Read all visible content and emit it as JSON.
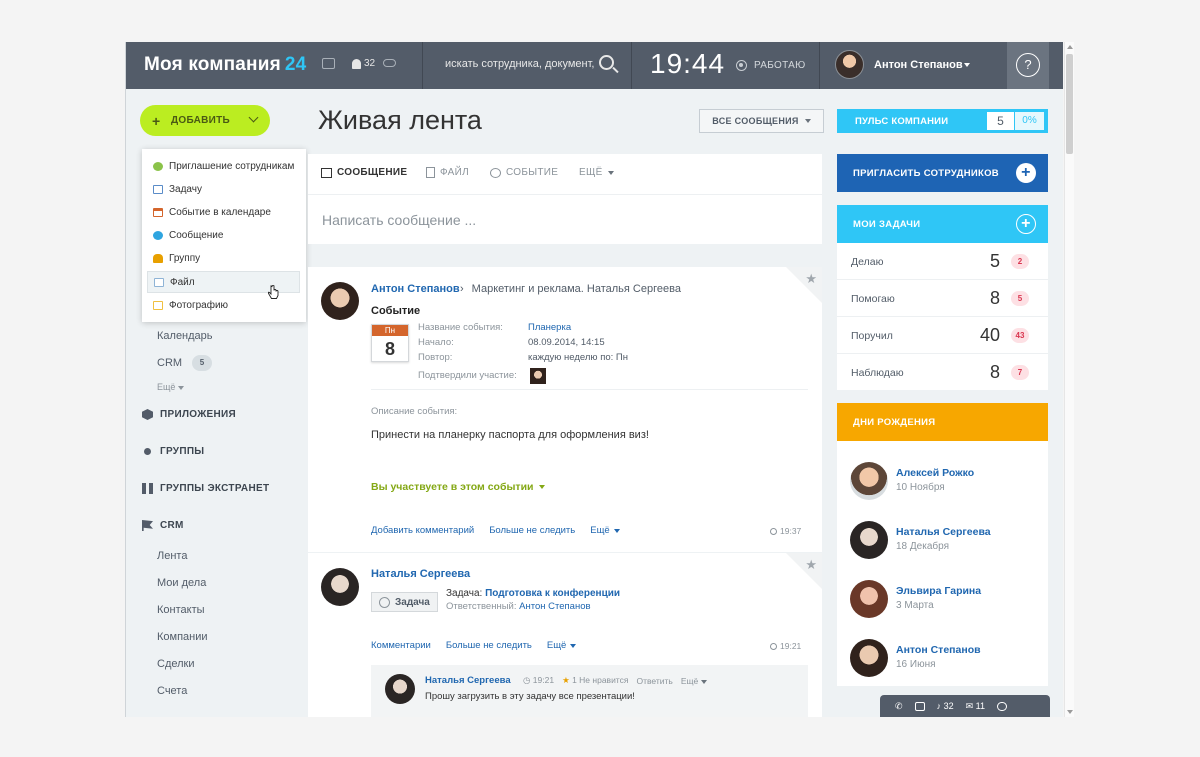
{
  "header": {
    "logo_text": "Моя компания",
    "logo_num": "24",
    "notifications_count": "32",
    "search_placeholder": "искать сотрудника, документ,",
    "clock": "19:44",
    "status": "РАБОТАЮ",
    "user_name": "Антон Степанов",
    "help": "?"
  },
  "sidebar": {
    "add_button": "ДОБАВИТЬ",
    "add_menu": [
      {
        "label": "Приглашение сотрудникам",
        "color": "#8bc34a"
      },
      {
        "label": "Задачу",
        "color": "#5a8cc8"
      },
      {
        "label": "Событие в календаре",
        "color": "#d4652c"
      },
      {
        "label": "Сообщение",
        "color": "#2fa5e0"
      },
      {
        "label": "Группу",
        "color": "#e8a000"
      },
      {
        "label": "Файл",
        "color": "#8fb4d6"
      },
      {
        "label": "Фотографию",
        "color": "#f0c040"
      }
    ],
    "calendar": "Календарь",
    "crm": "CRM",
    "crm_badge": "5",
    "more": "Ещё",
    "sections": {
      "apps": "ПРИЛОЖЕНИЯ",
      "groups": "ГРУППЫ",
      "extranet": "ГРУППЫ ЭКСТРАНЕТ",
      "crm": "CRM"
    },
    "crm_items": [
      "Лента",
      "Мои дела",
      "Контакты",
      "Компании",
      "Сделки",
      "Счета"
    ]
  },
  "feed": {
    "title": "Живая лента",
    "filter": "ВСЕ СООБЩЕНИЯ",
    "composer": {
      "tabs": [
        "СООБЩЕНИЕ",
        "ФАЙЛ",
        "СОБЫТИЕ",
        "ЕЩЁ"
      ],
      "placeholder": "Написать сообщение ..."
    },
    "post1": {
      "author": "Антон Степанов",
      "destination": "Маркетинг и реклама. Наталья Сергеева",
      "title": "Событие",
      "cal_weekday": "Пн",
      "cal_day": "8",
      "fields": [
        {
          "label": "Название события:",
          "value": "Планерка"
        },
        {
          "label": "Начало:",
          "value": "08.09.2014, 14:15"
        },
        {
          "label": "Повтор:",
          "value": "каждую неделю по: Пн"
        },
        {
          "label": "Подтвердили участие:",
          "value": ""
        }
      ],
      "desc_label": "Описание события:",
      "desc_text": "Принести на планерку паспорта для оформления виз!",
      "participate": "Вы участвуете в этом событии",
      "actions": [
        "Добавить комментарий",
        "Больше не следить",
        "Ещё"
      ],
      "time": "19:37"
    },
    "post2": {
      "author": "Наталья Сергеева",
      "task_badge": "Задача",
      "task_label": "Задача:",
      "task_link": "Подготовка к конференции",
      "resp_label": "Ответственный:",
      "resp_name": "Антон Степанов",
      "actions": [
        "Комментарии",
        "Больше не следить",
        "Ещё"
      ],
      "time": "19:21",
      "comment": {
        "author": "Наталья Сергеева",
        "time": "19:21",
        "likes": "1",
        "unlike": "Не нравится",
        "reply": "Ответить",
        "more": "Ещё",
        "text": "Прошу загрузить в эту задачу все презентации!"
      }
    }
  },
  "right": {
    "pulse_label": "ПУЛЬС КОМПАНИИ",
    "pulse_value": "5",
    "pulse_pct": "0%",
    "invite": "ПРИГЛАСИТЬ СОТРУДНИКОВ",
    "tasks_title": "МОИ ЗАДАЧИ",
    "tasks": [
      {
        "label": "Делаю",
        "count": "5",
        "badge": "2"
      },
      {
        "label": "Помогаю",
        "count": "8",
        "badge": "5"
      },
      {
        "label": "Поручил",
        "count": "40",
        "badge": "43"
      },
      {
        "label": "Наблюдаю",
        "count": "8",
        "badge": "7"
      }
    ],
    "birthdays_title": "ДНИ РОЖДЕНИЯ",
    "birthdays": [
      {
        "name": "Алексей Рожко",
        "date": "10 Ноября"
      },
      {
        "name": "Наталья Сергеева",
        "date": "18 Декабря"
      },
      {
        "name": "Эльвира Гарина",
        "date": "3 Марта"
      },
      {
        "name": "Антон Степанов",
        "date": "16 Июня"
      }
    ],
    "bottom_bar": {
      "notif": "32",
      "mail": "11"
    }
  },
  "colors": {
    "header": "#535c69",
    "accent_green": "#bbed21",
    "pulse": "#2fc6f6",
    "invite": "#1e64b4",
    "tasks": "#2fc6f6",
    "birthdays": "#f7a700"
  }
}
